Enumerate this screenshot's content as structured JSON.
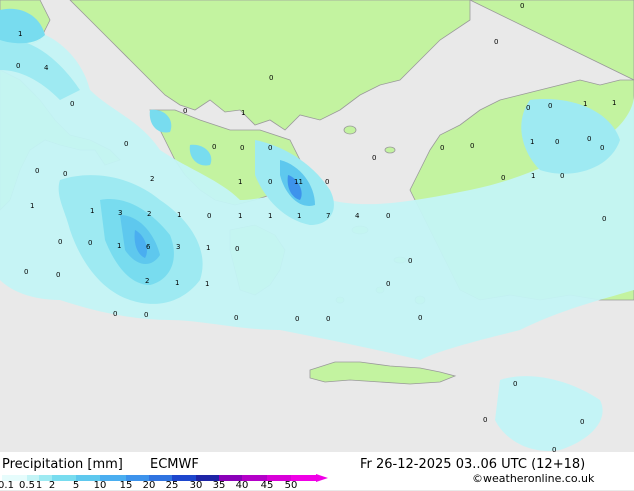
{
  "title": "Precipitation [mm]",
  "model": "ECMWF",
  "valid_time": "Fr 26-12-2025 03..06 UTC (12+18)",
  "credit": "©weatheronline.co.uk",
  "scale": {
    "labels": [
      "0.1",
      "0.5",
      "1",
      "2",
      "5",
      "10",
      "15",
      "20",
      "25",
      "30",
      "35",
      "40",
      "45",
      "50"
    ],
    "colors": [
      "#e6fcfc",
      "#c4f4f6",
      "#9eeaf2",
      "#78dcef",
      "#5ec8ee",
      "#4aaef0",
      "#3d93ec",
      "#2f73e0",
      "#1d46cd",
      "#1e24a6",
      "#8a00b8",
      "#b400c8",
      "#d800d8",
      "#f000e6"
    ]
  },
  "map_values": [
    "1",
    "4",
    "0",
    "0",
    "0",
    "0",
    "0",
    "0",
    "0",
    "0",
    "0",
    "0",
    "0",
    "0",
    "1",
    "1",
    "0",
    "0",
    "0",
    "0",
    "2",
    "1",
    "3",
    "2",
    "1",
    "0",
    "1",
    "1",
    "1",
    "1",
    "7",
    "4",
    "0",
    "0",
    "0",
    "1",
    "6",
    "3",
    "1",
    "0",
    "0",
    "0",
    "2",
    "1",
    "1",
    "0",
    "0",
    "0",
    "0",
    "0",
    "0",
    "0",
    "0",
    "0",
    "0",
    "0",
    "0",
    "0",
    "1",
    "1",
    "1",
    "0",
    "0",
    "0",
    "0",
    "1",
    "0",
    "0",
    "0",
    "11",
    "0"
  ]
}
